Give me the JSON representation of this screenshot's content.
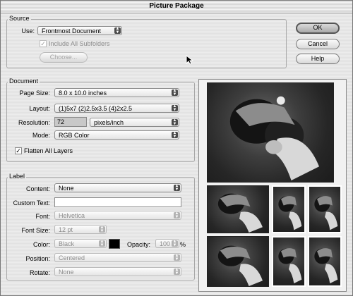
{
  "window": {
    "title": "Picture Package"
  },
  "buttons": {
    "ok": "OK",
    "cancel": "Cancel",
    "help": "Help"
  },
  "source": {
    "group_title": "Source",
    "use_label": "Use:",
    "use_value": "Frontmost Document",
    "include_subfolders": "Include All Subfolders",
    "include_subfolders_checked": true,
    "choose_button": "Choose..."
  },
  "document": {
    "group_title": "Document",
    "page_size_label": "Page Size:",
    "page_size_value": "8.0 x 10.0 inches",
    "layout_label": "Layout:",
    "layout_value": "(1)5x7 (2)2.5x3.5 (4)2x2.5",
    "resolution_label": "Resolution:",
    "resolution_value": "72",
    "resolution_unit": "pixels/inch",
    "mode_label": "Mode:",
    "mode_value": "RGB Color",
    "flatten_label": "Flatten All Layers",
    "flatten_checked": true
  },
  "label": {
    "group_title": "Label",
    "content_label": "Content:",
    "content_value": "None",
    "custom_text_label": "Custom Text:",
    "custom_text_value": "",
    "font_label": "Font:",
    "font_value": "Helvetica",
    "font_size_label": "Font Size:",
    "font_size_value": "12 pt",
    "color_label": "Color:",
    "color_value": "Black",
    "color_swatch": "#000000",
    "opacity_label": "Opacity:",
    "opacity_value": "100",
    "opacity_unit": "%",
    "position_label": "Position:",
    "position_value": "Centered",
    "rotate_label": "Rotate:",
    "rotate_value": "None"
  },
  "icons": {
    "popup_arrows": "updown-arrows-icon",
    "checkmark": "checkmark-icon",
    "cursor": "mouse-pointer-icon"
  },
  "colors": {
    "default_button": "#a9a9a9",
    "swatch": "#000000"
  }
}
